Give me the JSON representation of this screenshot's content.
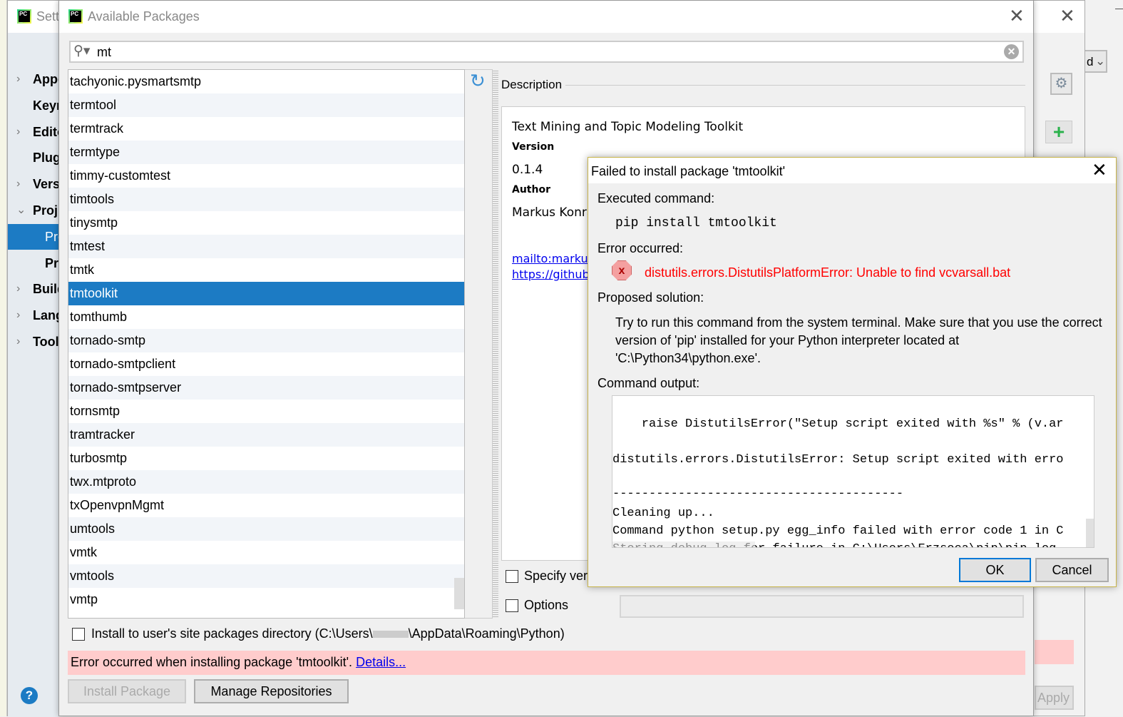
{
  "settings": {
    "title": "Sett",
    "sidebar": [
      {
        "label": "Appe",
        "chevron": "right"
      },
      {
        "label": "Keyr",
        "chevron": ""
      },
      {
        "label": "Edito",
        "chevron": "right"
      },
      {
        "label": "Plug",
        "chevron": ""
      },
      {
        "label": "Vers",
        "chevron": "right"
      },
      {
        "label": "Proj",
        "chevron": "down"
      },
      {
        "label": "Pro",
        "chevron": "",
        "selected": true
      },
      {
        "label": "Pro",
        "chevron": ""
      },
      {
        "label": "Build",
        "chevron": "right"
      },
      {
        "label": "Lang",
        "chevron": "right"
      },
      {
        "label": "Tool",
        "chevron": "right"
      }
    ],
    "apply_label": "Apply"
  },
  "ide": {
    "dropdown_text": "d"
  },
  "available_packages": {
    "title": "Available Packages",
    "search_value": "mt",
    "packages": [
      "tachyonic.pysmartsmtp",
      "termtool",
      "termtrack",
      "termtype",
      "timmy-customtest",
      "timtools",
      "tinysmtp",
      "tmtest",
      "tmtk",
      "tmtoolkit",
      "tomthumb",
      "tornado-smtp",
      "tornado-smtpclient",
      "tornado-smtpserver",
      "tornsmtp",
      "tramtracker",
      "turbosmtp",
      "twx.mtproto",
      "txOpenvpnMgmt",
      "umtools",
      "vmtk",
      "vmtools",
      "vmtp"
    ],
    "selected_package": "tmtoolkit",
    "description": {
      "header": "Description",
      "summary": "Text Mining and Topic Modeling Toolkit",
      "version_label": "Version",
      "version": "0.1.4",
      "author_label": "Author",
      "author": "Markus Konra",
      "link_mail": "mailto:markus",
      "link_github": "https://github."
    },
    "specify_version_label": "Specify vers",
    "options_label": "Options",
    "install_user_label": "Install to user's site packages directory (C:\\Users\\",
    "install_user_path_tail": "\\AppData\\Roaming\\Python)",
    "error_message": "Error occurred when installing package 'tmtoolkit'.",
    "details_link": "Details...",
    "install_button": "Install Package",
    "manage_repos_button": "Manage Repositories"
  },
  "failed_dialog": {
    "title": "Failed to install package 'tmtoolkit'",
    "executed_label": "Executed command:",
    "command": "pip install tmtoolkit",
    "error_label": "Error occurred:",
    "error_text": "distutils.errors.DistutilsPlatformError: Unable to find vcvarsall.bat",
    "solution_label": "Proposed solution:",
    "solution_lines": [
      "Try to run this command from the system terminal. Make sure that you use the correct",
      "version of 'pip' installed for your Python interpreter located at",
      "'C:\\Python34\\python.exe'."
    ],
    "output_label": "Command output:",
    "output_lines": [
      "    raise DistutilsError(\"Setup script exited with %s\" % (v.ar",
      "distutils.errors.DistutilsError: Setup script exited with erro",
      "----------------------------------------",
      "Cleaning up...",
      "Command python setup.py egg_info failed with error code 1 in C",
      "Storing debug log for failure in C:\\Users\\Erzsoca\\pip\\pip.log"
    ],
    "ok_label": "OK",
    "cancel_label": "Cancel"
  },
  "colors": {
    "selection": "#1c7bc4",
    "error_bg": "#ffcccc",
    "error_text": "#ff0000",
    "link": "#0000ee",
    "ok_border": "#0078d7"
  }
}
